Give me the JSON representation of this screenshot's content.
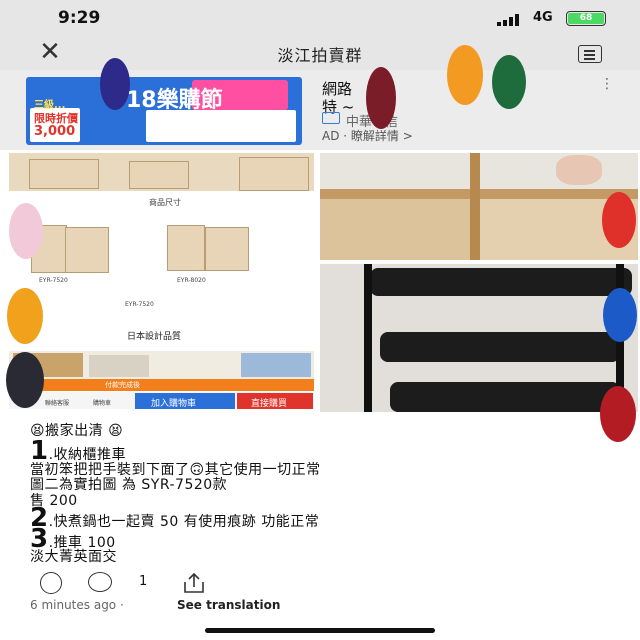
{
  "status_bar": {
    "time": "9:29",
    "network": "4G",
    "battery": "68"
  },
  "header": {
    "title": "淡江拍賣群"
  },
  "ad": {
    "title_line1": "網路",
    "title_line2": "特 ~",
    "advertiser": "中華電信",
    "label": "AD ·",
    "more_link": "瞭解詳情 >",
    "banner": {
      "big_text": "18樂購節",
      "left_badge": "三級...",
      "limit": "限時折價",
      "price": "3,000",
      "badge_colors": {
        "blue": "#2b6fd8",
        "pink": "#ff4fa3",
        "red": "#e0332b"
      }
    }
  },
  "photos": {
    "photo1": {
      "spec_title": "商品尺寸",
      "model_labels": [
        "EYR-7520",
        "EYR-8020",
        "EYR-7520"
      ],
      "catalog_title": "日本設計品質",
      "promo_text": "付款完成後",
      "bottom_bar": {
        "btn_add": "加入購物車",
        "btn_buy": "直接購買",
        "items": [
          "聯絡客服",
          "購物車"
        ]
      }
    }
  },
  "post": {
    "header_line": "搬家出清",
    "item1_num": "1",
    "item1": ".收納櫃推車",
    "line2": "當初笨把把手裝到下面了",
    "line2b": "其它使用一切正常",
    "line3": "圖二為實拍圖 為 SYR-7520款",
    "line4": "售 200",
    "item2_num": "2",
    "item2": ".快煮鍋也一起賣 50 有使用痕跡 功能正常",
    "item3_num": "3",
    "item3": ".推車 100",
    "line_last": "淡大菁英面交"
  },
  "footer": {
    "comment_count": "1",
    "timestamp": "6 minutes ago",
    "separator": "·",
    "translate": "See translation"
  },
  "colors": {
    "status_bg": "#e6e6e6",
    "battery_green": "#4cd964",
    "cart_blue": "#2b6fd8",
    "buy_red": "#e0332b"
  }
}
